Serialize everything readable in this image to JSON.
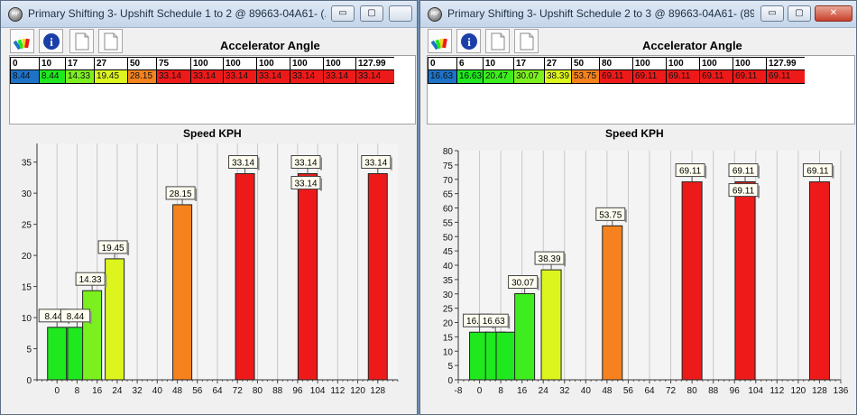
{
  "windows": [
    {
      "title": "Primary Shifting 3- Upshift Schedule 1 to 2  @ 89663-04A61- (...",
      "icon": "app-logo-icon",
      "grid_title": "Accelerator Angle",
      "headers": [
        "0",
        "10",
        "17",
        "27",
        "50",
        "75",
        "100",
        "100",
        "100",
        "100",
        "100",
        "127.99"
      ],
      "values": [
        "8.44",
        "8.44",
        "14.33",
        "19.45",
        "28.15",
        "33.14",
        "33.14",
        "33.14",
        "33.14",
        "33.14",
        "33.14",
        "33.14"
      ],
      "cell_colors": [
        "#1e73c8",
        "#1fe81f",
        "#7cf01f",
        "#dcf51e",
        "#f5821e",
        "#ee1a1a",
        "#ee1a1a",
        "#ee1a1a",
        "#ee1a1a",
        "#ee1a1a",
        "#ee1a1a",
        "#ee1a1a"
      ],
      "chart_title": "Speed KPH",
      "chart_data": {
        "type": "bar",
        "xlim": [
          -8,
          136
        ],
        "ylim": [
          0,
          38
        ],
        "x_ticks": [
          0,
          8,
          16,
          24,
          32,
          40,
          48,
          56,
          64,
          72,
          80,
          88,
          96,
          104,
          112,
          120,
          128
        ],
        "y_ticks": [
          0,
          5,
          10,
          15,
          20,
          25,
          30,
          35
        ],
        "bars": [
          {
            "x": 0,
            "value": 8.44,
            "label": "8.44",
            "color": "#1fe81f"
          },
          {
            "x": 8,
            "value": 8.44,
            "label": "8.44",
            "color": "#1fe81f"
          },
          {
            "x": 14,
            "value": 14.33,
            "label": "14.33",
            "color": "#7cf01f"
          },
          {
            "x": 23,
            "value": 19.45,
            "label": "19.45",
            "color": "#dcf51e"
          },
          {
            "x": 50,
            "value": 28.15,
            "label": "28.15",
            "color": "#f5821e"
          },
          {
            "x": 75,
            "value": 33.14,
            "label": "33.14",
            "color": "#ee1a1a"
          },
          {
            "x": 100,
            "value": 33.14,
            "label": "33.14",
            "color": "#ee1a1a"
          },
          {
            "x": 100,
            "value": 33.14,
            "label": "33.14",
            "color": "#ee1a1a"
          },
          {
            "x": 128,
            "value": 33.14,
            "label": "33.14",
            "color": "#ee1a1a"
          }
        ]
      }
    },
    {
      "title": "Primary Shifting 3- Upshift Schedule 2 to 3 @ 89663-04A61- (89...",
      "icon": "app-logo-icon",
      "grid_title": "Accelerator Angle",
      "headers": [
        "0",
        "6",
        "10",
        "17",
        "27",
        "50",
        "80",
        "100",
        "100",
        "100",
        "100",
        "127.99"
      ],
      "values": [
        "16.63",
        "16.63",
        "20.47",
        "30.07",
        "38.39",
        "53.75",
        "69.11",
        "69.11",
        "69.11",
        "69.11",
        "69.11",
        "69.11"
      ],
      "cell_colors": [
        "#1e73c8",
        "#1fe81f",
        "#3ded1f",
        "#7cf01f",
        "#dcf51e",
        "#f5821e",
        "#ee1a1a",
        "#ee1a1a",
        "#ee1a1a",
        "#ee1a1a",
        "#ee1a1a",
        "#ee1a1a"
      ],
      "chart_title": "Speed KPH",
      "chart_data": {
        "type": "bar",
        "xlim": [
          -8,
          136
        ],
        "ylim": [
          0,
          80
        ],
        "x_ticks": [
          -8,
          0,
          8,
          16,
          24,
          32,
          40,
          48,
          56,
          64,
          72,
          80,
          88,
          96,
          104,
          112,
          120,
          128,
          136
        ],
        "y_ticks": [
          0,
          5,
          10,
          15,
          20,
          25,
          30,
          35,
          40,
          45,
          50,
          55,
          60,
          65,
          70,
          75,
          80
        ],
        "bars": [
          {
            "x": 0,
            "value": 16.63,
            "label": "16.63",
            "color": "#1fe81f"
          },
          {
            "x": 6,
            "value": 16.63,
            "label": "16.63",
            "color": "#1fe81f"
          },
          {
            "x": 10,
            "value": 16.63,
            "label": "",
            "color": "#1fe81f"
          },
          {
            "x": 17,
            "value": 30.07,
            "label": "30.07",
            "color": "#3ded1f"
          },
          {
            "x": 27,
            "value": 38.39,
            "label": "38.39",
            "color": "#dcf51e"
          },
          {
            "x": 50,
            "value": 53.75,
            "label": "53.75",
            "color": "#f5821e"
          },
          {
            "x": 80,
            "value": 69.11,
            "label": "69.11",
            "color": "#ee1a1a"
          },
          {
            "x": 100,
            "value": 69.11,
            "label": "69.11",
            "color": "#ee1a1a"
          },
          {
            "x": 100,
            "value": 69.11,
            "label": "69.11",
            "color": "#ee1a1a"
          },
          {
            "x": 128,
            "value": 69.11,
            "label": "69.11",
            "color": "#ee1a1a"
          }
        ]
      }
    }
  ],
  "toolbar": {
    "buttons": [
      "palette-icon",
      "info-icon",
      "new-document-icon",
      "copy-document-icon"
    ]
  },
  "window_buttons": {
    "minimize": "▭",
    "maximize": "▢",
    "close": "✕"
  }
}
